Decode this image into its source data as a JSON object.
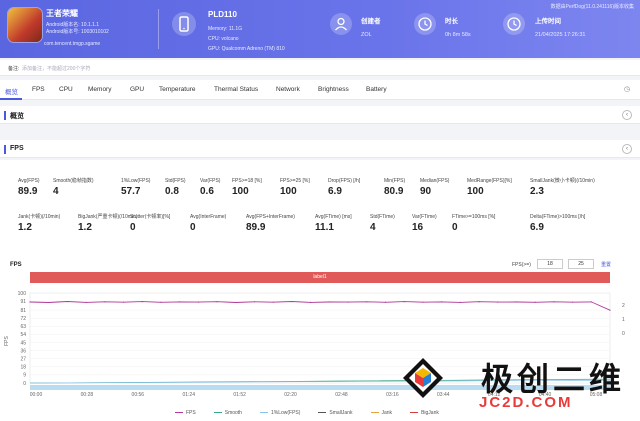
{
  "header": {
    "game_name": "王者荣耀",
    "android_version": "Android版本名: 10.1.1.1",
    "android_code": "Android版本号: 1003010102",
    "package": "com.tencent.tmgp.sgame",
    "device_name": "PLD110",
    "memory": "Memory: 11.1G",
    "cpu": "CPU: volcano",
    "gpu": "GPU: Qualcomm Adreno (TM) 810",
    "creator_label": "创建者",
    "creator_value": "ZOL",
    "duration_label": "时长",
    "duration_value": "0h 8m 58s",
    "upload_label": "上传时间",
    "upload_value": "21/04/2025 17:26:31",
    "version": "数据由PerfDog(11.0.241116)版本收集"
  },
  "remark": {
    "label": "备注:",
    "placeholder": "添加备注，不能超过200个字符"
  },
  "tabs": [
    "概览",
    "FPS",
    "CPU",
    "Memory",
    "GPU",
    "Temperature",
    "Thermal Status",
    "Network",
    "Brightness",
    "Battery"
  ],
  "tab_end_icon": "◷",
  "sections": {
    "overview": "概览",
    "fps": "FPS"
  },
  "stats_row1": [
    {
      "label": "Avg(FPS)",
      "value": "89.9"
    },
    {
      "label": "Smooth(稳帧指数)",
      "value": "4"
    },
    {
      "label": "1%Low(FPS)",
      "value": "57.7"
    },
    {
      "label": "Std(FPS)",
      "value": "0.8"
    },
    {
      "label": "Var(FPS)",
      "value": "0.6"
    },
    {
      "label": "FPS>=18 [%]",
      "value": "100"
    },
    {
      "label": "FPS>=25 [%]",
      "value": "100"
    },
    {
      "label": "Drop(FPS) [/h]",
      "value": "6.9"
    },
    {
      "label": "Min(FPS)",
      "value": "80.9"
    },
    {
      "label": "Median(FPS)",
      "value": "90"
    },
    {
      "label": "MedRange(FPS)[%]",
      "value": "100"
    },
    {
      "label": "SmallJank(微小卡顿)(/10min)",
      "value": "2.3"
    }
  ],
  "stats_row2": [
    {
      "label": "Jank(卡顿)(/10min)",
      "value": "1.2"
    },
    {
      "label": "BigJank(严重卡顿)(/10min)",
      "value": "1.2"
    },
    {
      "label": "Stutter(卡顿率)[%]",
      "value": "0"
    },
    {
      "label": "Avg(InterFrame)",
      "value": "0"
    },
    {
      "label": "Avg(FPS+InterFrame)",
      "value": "89.9"
    },
    {
      "label": "Avg(FTime) [ms]",
      "value": "11.1"
    },
    {
      "label": "Std(FTime)",
      "value": "4"
    },
    {
      "label": "Var(FTime)",
      "value": "16"
    },
    {
      "label": "FTime>=100ms [%]",
      "value": "0"
    },
    {
      "label": "Delta(FTime)>100ms [/h]",
      "value": "6.9"
    }
  ],
  "chart_controls": {
    "title": "FPS",
    "fps_label": "FPS(>=)",
    "fps_min": "18",
    "fps_max": "25",
    "reset": "重置",
    "label_bar": "label1"
  },
  "chart_data": {
    "type": "line",
    "title": "FPS",
    "xlabel": "",
    "ylabel": "FPS",
    "y_ticks": [
      0,
      9,
      18,
      27,
      36,
      45,
      54,
      63,
      72,
      81,
      91,
      100
    ],
    "ylim": [
      0,
      100
    ],
    "x_ticks": [
      "00:00",
      "00:28",
      "00:56",
      "01:24",
      "01:52",
      "02:20",
      "02:48",
      "03:16",
      "03:44",
      "04:12",
      "04:40",
      "05:08"
    ],
    "right_ticks": [
      "2",
      "1",
      "0"
    ],
    "series": [
      {
        "name": "FPS",
        "color": "#b23a9a",
        "values": [
          90,
          89.5,
          90.5,
          89.6,
          90.2,
          89.8,
          90.4,
          89.7,
          90.1,
          89.9,
          90.3,
          89.5,
          90.2,
          89.8,
          90.5,
          89.6,
          90.0,
          89.9,
          90.2,
          89.7,
          90.4,
          89.8,
          90.1,
          89.6,
          90.3,
          89.9,
          90.0,
          89.7,
          90.2,
          89.8,
          90.1,
          80.9
        ]
      },
      {
        "name": "Smooth",
        "color": "#3aa58a",
        "values": [
          0,
          0.2,
          0.4,
          0.7,
          1.0,
          1.3,
          1.6,
          1.9,
          2.2,
          2.5,
          2.8,
          3.1,
          3.4,
          3.7,
          4.0,
          4.3
        ]
      },
      {
        "name": "1%Low(FPS)",
        "color": "#8ac4e8",
        "values": [
          0,
          0.1,
          0.3,
          0.5,
          0.7,
          0.9,
          1.2,
          1.4,
          1.6,
          1.8,
          2.0,
          2.2,
          2.4,
          2.6,
          2.8,
          3.0
        ]
      }
    ],
    "legend": [
      "FPS",
      "Smooth",
      "1%Low(FPS)",
      "SmallJank",
      "Jank",
      "BigJank"
    ],
    "legend_colors": [
      "#b23a9a",
      "#3aa58a",
      "#8ac4e8",
      "#555555",
      "#e8a040",
      "#d04040"
    ],
    "legend_position": "bottom"
  },
  "watermark": {
    "text": "极创二维",
    "sub": "JC2D.COM"
  }
}
